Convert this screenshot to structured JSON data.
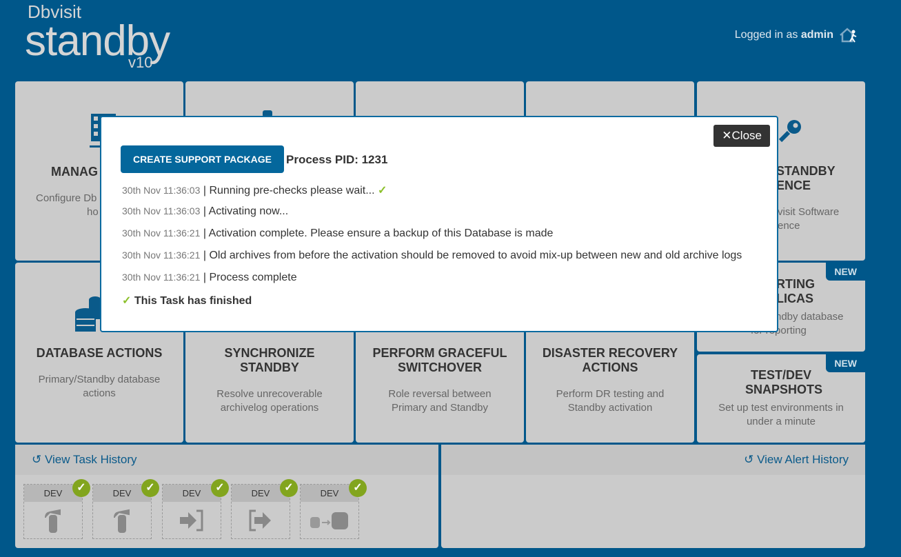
{
  "header": {
    "logo_brand": "Dbvisit",
    "logo_product": "standby",
    "logo_version": "v10",
    "logged_in_prefix": "Logged in as",
    "user": "admin"
  },
  "cards": [
    {
      "title": "MANAG",
      "desc1": "Configure Db",
      "desc2": "ho"
    },
    {
      "title": "STANDBY",
      "title2": "ENCE",
      "desc1": "visit Software",
      "desc2": "ence"
    },
    {
      "title": "DATABASE ACTIONS",
      "desc": "Primary/Standby database actions"
    },
    {
      "title": "SYNCHRONIZE STANDBY",
      "desc": "Resolve unrecoverable archivelog operations"
    },
    {
      "title": "PERFORM GRACEFUL SWITCHOVER",
      "desc": "Role reversal between Primary and Standby"
    },
    {
      "title": "DISASTER RECOVERY ACTIONS",
      "desc": "Perform DR testing and Standby activation"
    },
    {
      "title": "RTING",
      "title2": "LICAS",
      "desc1": "ndby database",
      "desc2": "for reporting",
      "badge": "NEW"
    },
    {
      "title": "TEST/DEV SNAPSHOTS",
      "desc": "Set up test environments in under a minute",
      "badge": "NEW"
    }
  ],
  "task_history": {
    "label": "View Task History",
    "tasks": [
      {
        "db": "DEV",
        "icon": "fire-extinguisher-icon",
        "status": "success"
      },
      {
        "db": "DEV",
        "icon": "fire-extinguisher-icon",
        "status": "success"
      },
      {
        "db": "DEV",
        "icon": "sign-in-icon",
        "status": "success"
      },
      {
        "db": "DEV",
        "icon": "sign-out-icon",
        "status": "success"
      },
      {
        "db": "DEV",
        "icon": "database-transfer-icon",
        "status": "success"
      }
    ]
  },
  "alert_history": {
    "label": "View Alert History"
  },
  "modal": {
    "close_label": "Close",
    "support_button": "CREATE SUPPORT PACKAGE",
    "pid": "Process PID: 1231",
    "log": [
      {
        "ts": "30th Nov 11:36:03",
        "msg": "Running pre-checks please wait..."
      },
      {
        "ts": "30th Nov 11:36:03",
        "msg": "Activating now..."
      },
      {
        "ts": "30th Nov 11:36:21",
        "msg": "Activation complete. Please ensure a backup of this Database is made"
      },
      {
        "ts": "30th Nov 11:36:21",
        "msg": "Old archives from before the activation should be removed to avoid mix-up between new and old archive logs"
      },
      {
        "ts": "30th Nov 11:36:21",
        "msg": "Process complete"
      }
    ],
    "finished": "This Task has finished"
  },
  "colors": {
    "background": "#00578a",
    "card": "#cbcbcb",
    "accent": "#04679c",
    "success": "#82a51e"
  }
}
